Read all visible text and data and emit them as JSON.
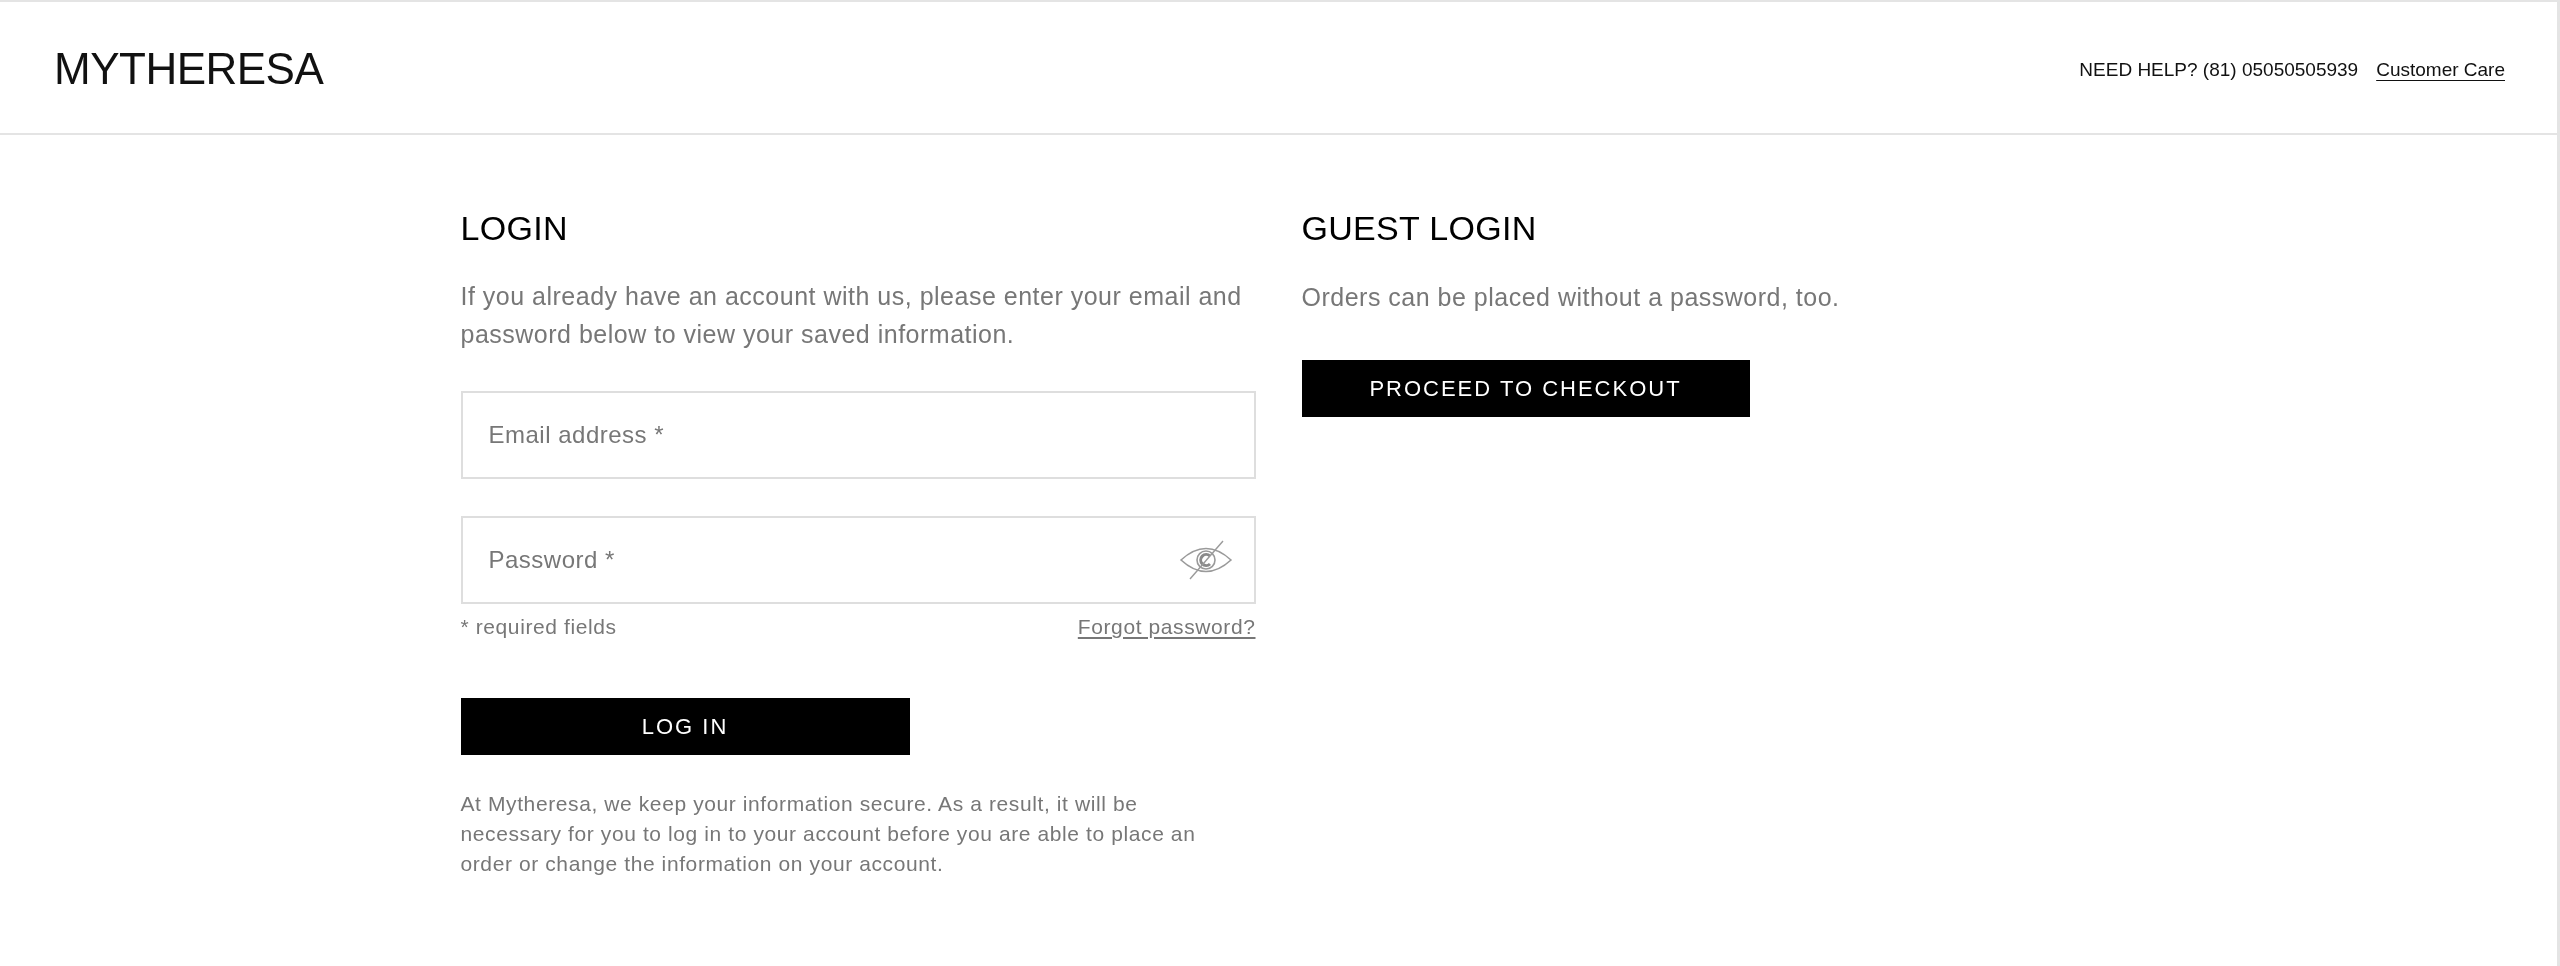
{
  "header": {
    "logo": "MYTHERESA",
    "help_text": "NEED HELP? (81) 05050505939",
    "help_link": "Customer Care"
  },
  "login": {
    "title": "LOGIN",
    "intro": "If you already have an account with us, please enter your email and password below to view your saved information.",
    "fields": [
      {
        "kind": "email",
        "placeholder": "Email address *"
      },
      {
        "kind": "password",
        "placeholder": "Password *"
      }
    ],
    "required_note": "* required fields",
    "forgot_link": "Forgot password?",
    "button": "LOG IN",
    "security_note": "At Mytheresa, we keep your information secure. As a result, it will be necessary for you to log in to your account before you are able to place an order or change the information on your account."
  },
  "guest_login": {
    "title": "GUEST LOGIN",
    "text": "Orders can be placed without a password, too.",
    "button": "PROCEED TO CHECKOUT"
  }
}
